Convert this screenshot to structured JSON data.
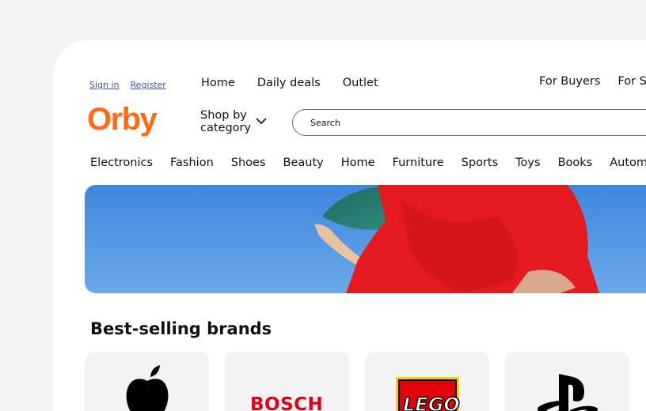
{
  "auth": {
    "sign_in": "Sign in",
    "register": "Register"
  },
  "top_nav": [
    "Home",
    "Daily deals",
    "Outlet"
  ],
  "right_nav": [
    "For Buyers",
    "For Sellers"
  ],
  "logo": "Orby",
  "shop_by": "Shop by category",
  "search": {
    "placeholder": "Search"
  },
  "categories": [
    "Electronics",
    "Fashion",
    "Shoes",
    "Beauty",
    "Home",
    "Furniture",
    "Sports",
    "Toys",
    "Books",
    "Automotive"
  ],
  "brands_section": {
    "title": "Best-selling brands"
  },
  "brands": [
    {
      "name": "apple-icon"
    },
    {
      "label": "BOSCH",
      "color": "#e20015"
    },
    {
      "label": "LEGO",
      "color": "#e3000b"
    },
    {
      "name": "playstation-icon"
    }
  ],
  "colors": {
    "brand": "#ff6a13",
    "link": "#3b55c9",
    "sky": "#4a8fdf",
    "dress": "#e51a20"
  }
}
